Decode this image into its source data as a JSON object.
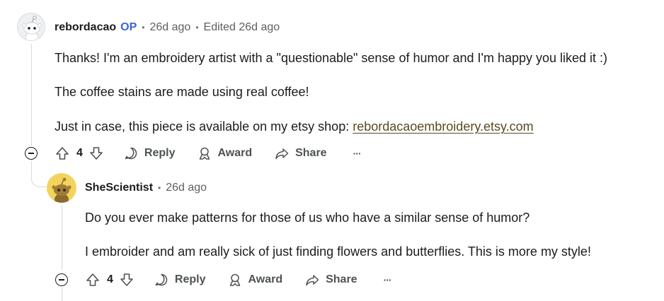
{
  "comments": [
    {
      "username": "rebordacao",
      "op_badge": "OP",
      "time": "26d ago",
      "edited": "Edited 26d ago",
      "paragraphs": [
        "Thanks! I'm an embroidery artist with a \"questionable\" sense of humor and I'm happy you liked it :)",
        "The coffee stains are made using real coffee!"
      ],
      "link_prefix": "Just in case, this piece is available on my etsy shop: ",
      "link_text": "rebordacaoembroidery.etsy.com",
      "votes": "4",
      "reply_label": "Reply",
      "award_label": "Award",
      "share_label": "Share",
      "more_label": "···"
    },
    {
      "username": "SheScientist",
      "time": "26d ago",
      "paragraphs": [
        "Do you ever make patterns for those of us who have a similar sense of humor?",
        "I embroider and am really sick of just finding flowers and butterflies. This is more my style!"
      ],
      "votes": "4",
      "reply_label": "Reply",
      "award_label": "Award",
      "share_label": "Share",
      "more_label": "···"
    }
  ],
  "colors": {
    "op_badge": "#3b66d6",
    "link": "#5a4a22",
    "avatar2_bg": "#f2d45c",
    "thread_line": "#d8dade"
  }
}
